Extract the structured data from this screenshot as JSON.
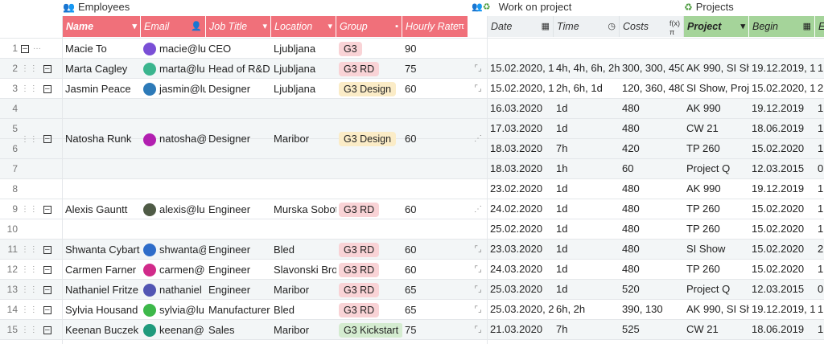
{
  "groups": {
    "employees": "Employees",
    "work": "Work on project",
    "projects": "Projects"
  },
  "headers": {
    "name": "Name",
    "email": "Email",
    "job": "Job Title",
    "location": "Location",
    "group": "Group",
    "rate": "Hourly Rate",
    "date": "Date",
    "time": "Time",
    "costs": "Costs",
    "project": "Project",
    "begin": "Begin",
    "e": "E"
  },
  "rows": [
    {
      "n": "1",
      "name": "Macie To",
      "email": "macie@lu",
      "job": "CEO",
      "loc": "Ljubljana",
      "group": "G3",
      "rate": "90",
      "date": "",
      "time": "",
      "costs": "",
      "project": "",
      "begin": "",
      "e": ""
    },
    {
      "n": "2",
      "name": "Marta Cagley",
      "email": "marta@lu",
      "job": "Head of R&D",
      "loc": "Ljubljana",
      "group": "G3 RD",
      "rate": "75",
      "date": "15.02.2020, 1!",
      "time": "4h, 4h, 6h, 2h",
      "costs": "300, 300, 450,",
      "project": "AK 990, SI Sho",
      "begin": "19.12.2019, 1!",
      "e": "1"
    },
    {
      "n": "3",
      "name": "Jasmin Peace",
      "email": "jasmin@lu",
      "job": "Designer",
      "loc": "Ljubljana",
      "group": "G3 Design",
      "rate": "60",
      "date": "15.02.2020, 1!",
      "time": "2h, 6h, 1d",
      "costs": "120, 360, 480",
      "project": "SI Show, Proje",
      "begin": "15.02.2020, 1:",
      "e": "2"
    },
    {
      "n": "4",
      "name": "",
      "email": "",
      "job": "",
      "loc": "",
      "group": "",
      "rate": "",
      "date": "16.03.2020",
      "time": "1d",
      "costs": "480",
      "project": "AK 990",
      "begin": "19.12.2019",
      "e": "1"
    },
    {
      "n": "5",
      "name": "Natosha Runk",
      "email": "natosha@",
      "job": "Designer",
      "loc": "Maribor",
      "group": "G3 Design",
      "rate": "60",
      "date": "17.03.2020",
      "time": "1d",
      "costs": "480",
      "project": "CW 21",
      "begin": "18.06.2019",
      "e": "1"
    },
    {
      "n": "6",
      "name": "",
      "email": "",
      "job": "",
      "loc": "",
      "group": "",
      "rate": "",
      "date": "18.03.2020",
      "time": "7h",
      "costs": "420",
      "project": "TP 260",
      "begin": "15.02.2020",
      "e": "1"
    },
    {
      "n": "7",
      "name": "",
      "email": "",
      "job": "",
      "loc": "",
      "group": "",
      "rate": "",
      "date": "18.03.2020",
      "time": "1h",
      "costs": "60",
      "project": "Project Q",
      "begin": "12.03.2015",
      "e": "0"
    },
    {
      "n": "8",
      "name": "",
      "email": "",
      "job": "",
      "loc": "",
      "group": "",
      "rate": "",
      "date": "23.02.2020",
      "time": "1d",
      "costs": "480",
      "project": "AK 990",
      "begin": "19.12.2019",
      "e": "1"
    },
    {
      "n": "9",
      "name": "Alexis Gauntt",
      "email": "alexis@lu",
      "job": "Engineer",
      "loc": "Murska Sobot",
      "group": "G3 RD",
      "rate": "60",
      "date": "24.02.2020",
      "time": "1d",
      "costs": "480",
      "project": "TP 260",
      "begin": "15.02.2020",
      "e": "1"
    },
    {
      "n": "10",
      "name": "",
      "email": "",
      "job": "",
      "loc": "",
      "group": "",
      "rate": "",
      "date": "25.02.2020",
      "time": "1d",
      "costs": "480",
      "project": "TP 260",
      "begin": "15.02.2020",
      "e": "1"
    },
    {
      "n": "11",
      "name": "Shwanta Cybart",
      "email": "shwanta@",
      "job": "Engineer",
      "loc": "Bled",
      "group": "G3 RD",
      "rate": "60",
      "date": "23.03.2020",
      "time": "1d",
      "costs": "480",
      "project": "SI Show",
      "begin": "15.02.2020",
      "e": "2"
    },
    {
      "n": "12",
      "name": "Carmen Farner",
      "email": "carmen@",
      "job": "Engineer",
      "loc": "Slavonski Broc",
      "group": "G3 RD",
      "rate": "60",
      "date": "24.03.2020",
      "time": "1d",
      "costs": "480",
      "project": "TP 260",
      "begin": "15.02.2020",
      "e": "1"
    },
    {
      "n": "13",
      "name": "Nathaniel Fritze",
      "email": "nathaniel",
      "job": "Engineer",
      "loc": "Maribor",
      "group": "G3 RD",
      "rate": "65",
      "date": "25.03.2020",
      "time": "1d",
      "costs": "520",
      "project": "Project Q",
      "begin": "12.03.2015",
      "e": "0"
    },
    {
      "n": "14",
      "name": "Sylvia Housand",
      "email": "sylvia@lu",
      "job": "Manufacturer",
      "loc": "Bled",
      "group": "G3 RD",
      "rate": "65",
      "date": "25.03.2020, 2!",
      "time": "6h, 2h",
      "costs": "390, 130",
      "project": "AK 990, SI Sho",
      "begin": "19.12.2019, 1!",
      "e": "1"
    },
    {
      "n": "15",
      "name": "Keenan Buczek",
      "email": "keenan@",
      "job": "Sales",
      "loc": "Maribor",
      "group": "G3 Kickstart",
      "rate": "75",
      "date": "21.03.2020",
      "time": "7h",
      "costs": "525",
      "project": "CW 21",
      "begin": "18.06.2019",
      "e": "1"
    }
  ],
  "colors": {
    "red_header": "#f0707a",
    "green_header": "#a5d49a"
  }
}
